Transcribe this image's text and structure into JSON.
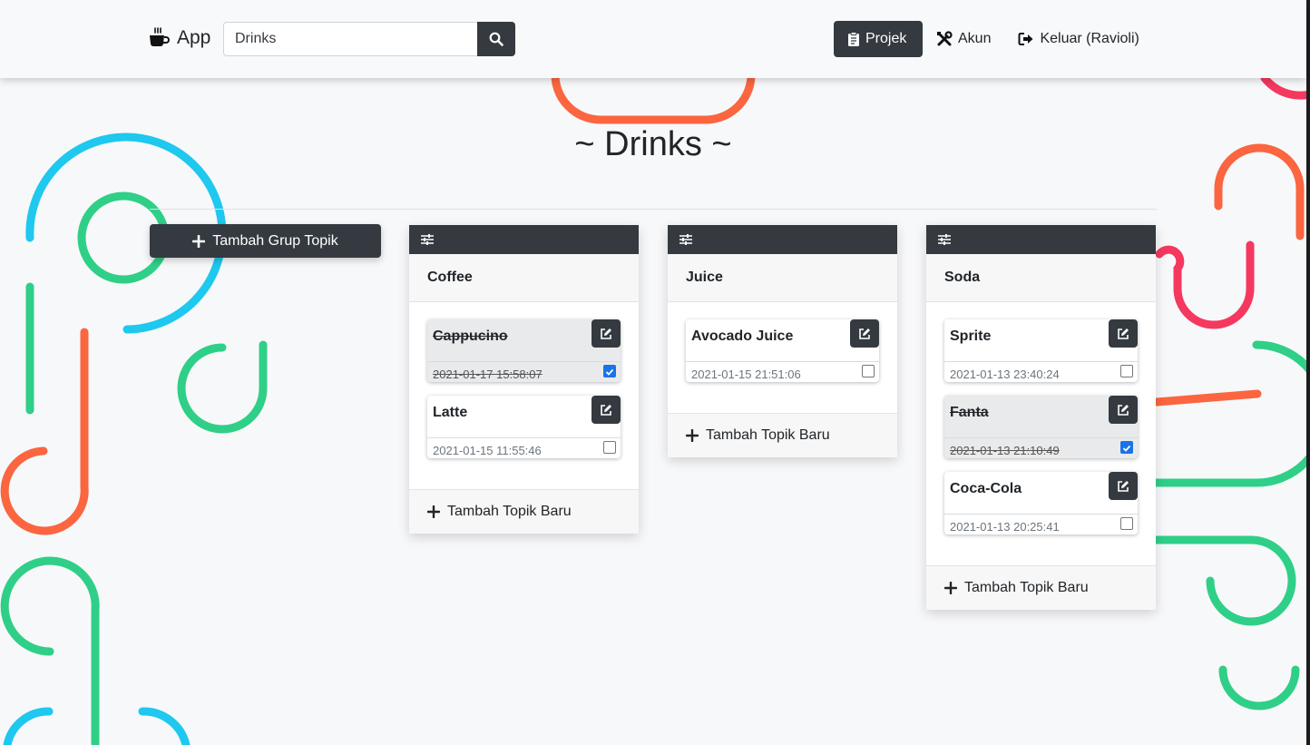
{
  "navbar": {
    "brand": "App",
    "search_value": "Drinks",
    "links": [
      {
        "label": "Projek",
        "icon": "clipboard-icon",
        "active": true
      },
      {
        "label": "Akun",
        "icon": "tools-icon",
        "active": false
      },
      {
        "label": "Keluar (Ravioli)",
        "icon": "sign-out-icon",
        "active": false
      }
    ]
  },
  "page": {
    "title": "~ Drinks ~",
    "add_group_label": "Tambah Grup Topik"
  },
  "groups": [
    {
      "name": "Coffee",
      "add_topic_label": "Tambah Topik Baru",
      "topics": [
        {
          "title": "Cappucino",
          "date": "2021-01-17 15:58:07",
          "done": true
        },
        {
          "title": "Latte",
          "date": "2021-01-15 11:55:46",
          "done": false
        }
      ]
    },
    {
      "name": "Juice",
      "add_topic_label": "Tambah Topik Baru",
      "topics": [
        {
          "title": "Avocado Juice",
          "date": "2021-01-15 21:51:06",
          "done": false
        }
      ]
    },
    {
      "name": "Soda",
      "add_topic_label": "Tambah Topik Baru",
      "topics": [
        {
          "title": "Sprite",
          "date": "2021-01-13 23:40:24",
          "done": false
        },
        {
          "title": "Fanta",
          "date": "2021-01-13 21:10:49",
          "done": true
        },
        {
          "title": "Coca-Cola",
          "date": "2021-01-13 20:25:41",
          "done": false
        }
      ]
    }
  ],
  "colors": {
    "dark": "#343a40",
    "deco_blue": "#1ec8ee",
    "deco_green": "#2fcf88",
    "deco_orange": "#fb6540",
    "deco_pink": "#f5385f",
    "check": "#1a73e8"
  }
}
